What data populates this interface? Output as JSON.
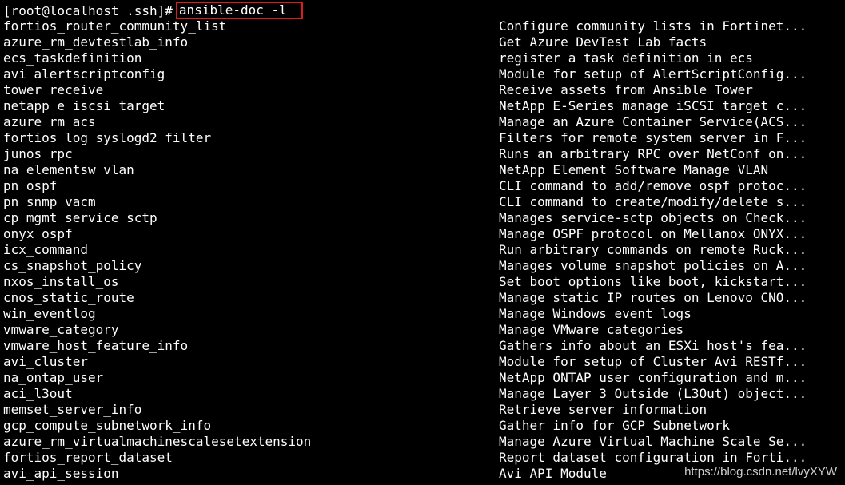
{
  "terminal": {
    "prompt": "[root@localhost .ssh]#",
    "command": "ansible-doc -l",
    "highlight_color": "#e01b1b",
    "rows": [
      {
        "name": "fortios_router_community_list",
        "desc": "Configure community lists in Fortinet..."
      },
      {
        "name": "azure_rm_devtestlab_info",
        "desc": "Get Azure DevTest Lab facts"
      },
      {
        "name": "ecs_taskdefinition",
        "desc": "register a task definition in ecs"
      },
      {
        "name": "avi_alertscriptconfig",
        "desc": "Module for setup of AlertScriptConfig..."
      },
      {
        "name": "tower_receive",
        "desc": "Receive assets from Ansible Tower"
      },
      {
        "name": "netapp_e_iscsi_target",
        "desc": "NetApp E-Series manage iSCSI target c..."
      },
      {
        "name": "azure_rm_acs",
        "desc": "Manage an Azure Container Service(ACS..."
      },
      {
        "name": "fortios_log_syslogd2_filter",
        "desc": "Filters for remote system server in F..."
      },
      {
        "name": "junos_rpc",
        "desc": "Runs an arbitrary RPC over NetConf on..."
      },
      {
        "name": "na_elementsw_vlan",
        "desc": "NetApp Element Software Manage VLAN"
      },
      {
        "name": "pn_ospf",
        "desc": "CLI command to add/remove ospf protoc..."
      },
      {
        "name": "pn_snmp_vacm",
        "desc": "CLI command to create/modify/delete s..."
      },
      {
        "name": "cp_mgmt_service_sctp",
        "desc": "Manages service-sctp objects on Check..."
      },
      {
        "name": "onyx_ospf",
        "desc": "Manage OSPF protocol on Mellanox ONYX..."
      },
      {
        "name": "icx_command",
        "desc": "Run arbitrary commands on remote Ruck..."
      },
      {
        "name": "cs_snapshot_policy",
        "desc": "Manages volume snapshot policies on A..."
      },
      {
        "name": "nxos_install_os",
        "desc": "Set boot options like boot, kickstart..."
      },
      {
        "name": "cnos_static_route",
        "desc": "Manage static IP routes on Lenovo CNO..."
      },
      {
        "name": "win_eventlog",
        "desc": "Manage Windows event logs"
      },
      {
        "name": "vmware_category",
        "desc": "Manage VMware categories"
      },
      {
        "name": "vmware_host_feature_info",
        "desc": "Gathers info about an ESXi host's fea..."
      },
      {
        "name": "avi_cluster",
        "desc": "Module for setup of Cluster Avi RESTf..."
      },
      {
        "name": "na_ontap_user",
        "desc": "NetApp ONTAP user configuration and m..."
      },
      {
        "name": "aci_l3out",
        "desc": "Manage Layer 3 Outside (L3Out) object..."
      },
      {
        "name": "memset_server_info",
        "desc": "Retrieve server information"
      },
      {
        "name": "gcp_compute_subnetwork_info",
        "desc": "Gather info for GCP Subnetwork"
      },
      {
        "name": "azure_rm_virtualmachinescalesetextension",
        "desc": "Manage Azure Virtual Machine Scale Se..."
      },
      {
        "name": "fortios_report_dataset",
        "desc": "Report dataset configuration in Forti..."
      },
      {
        "name": "avi_api_session",
        "desc": "Avi API Module"
      }
    ]
  },
  "watermark": "https://blog.csdn.net/lvyXYW"
}
